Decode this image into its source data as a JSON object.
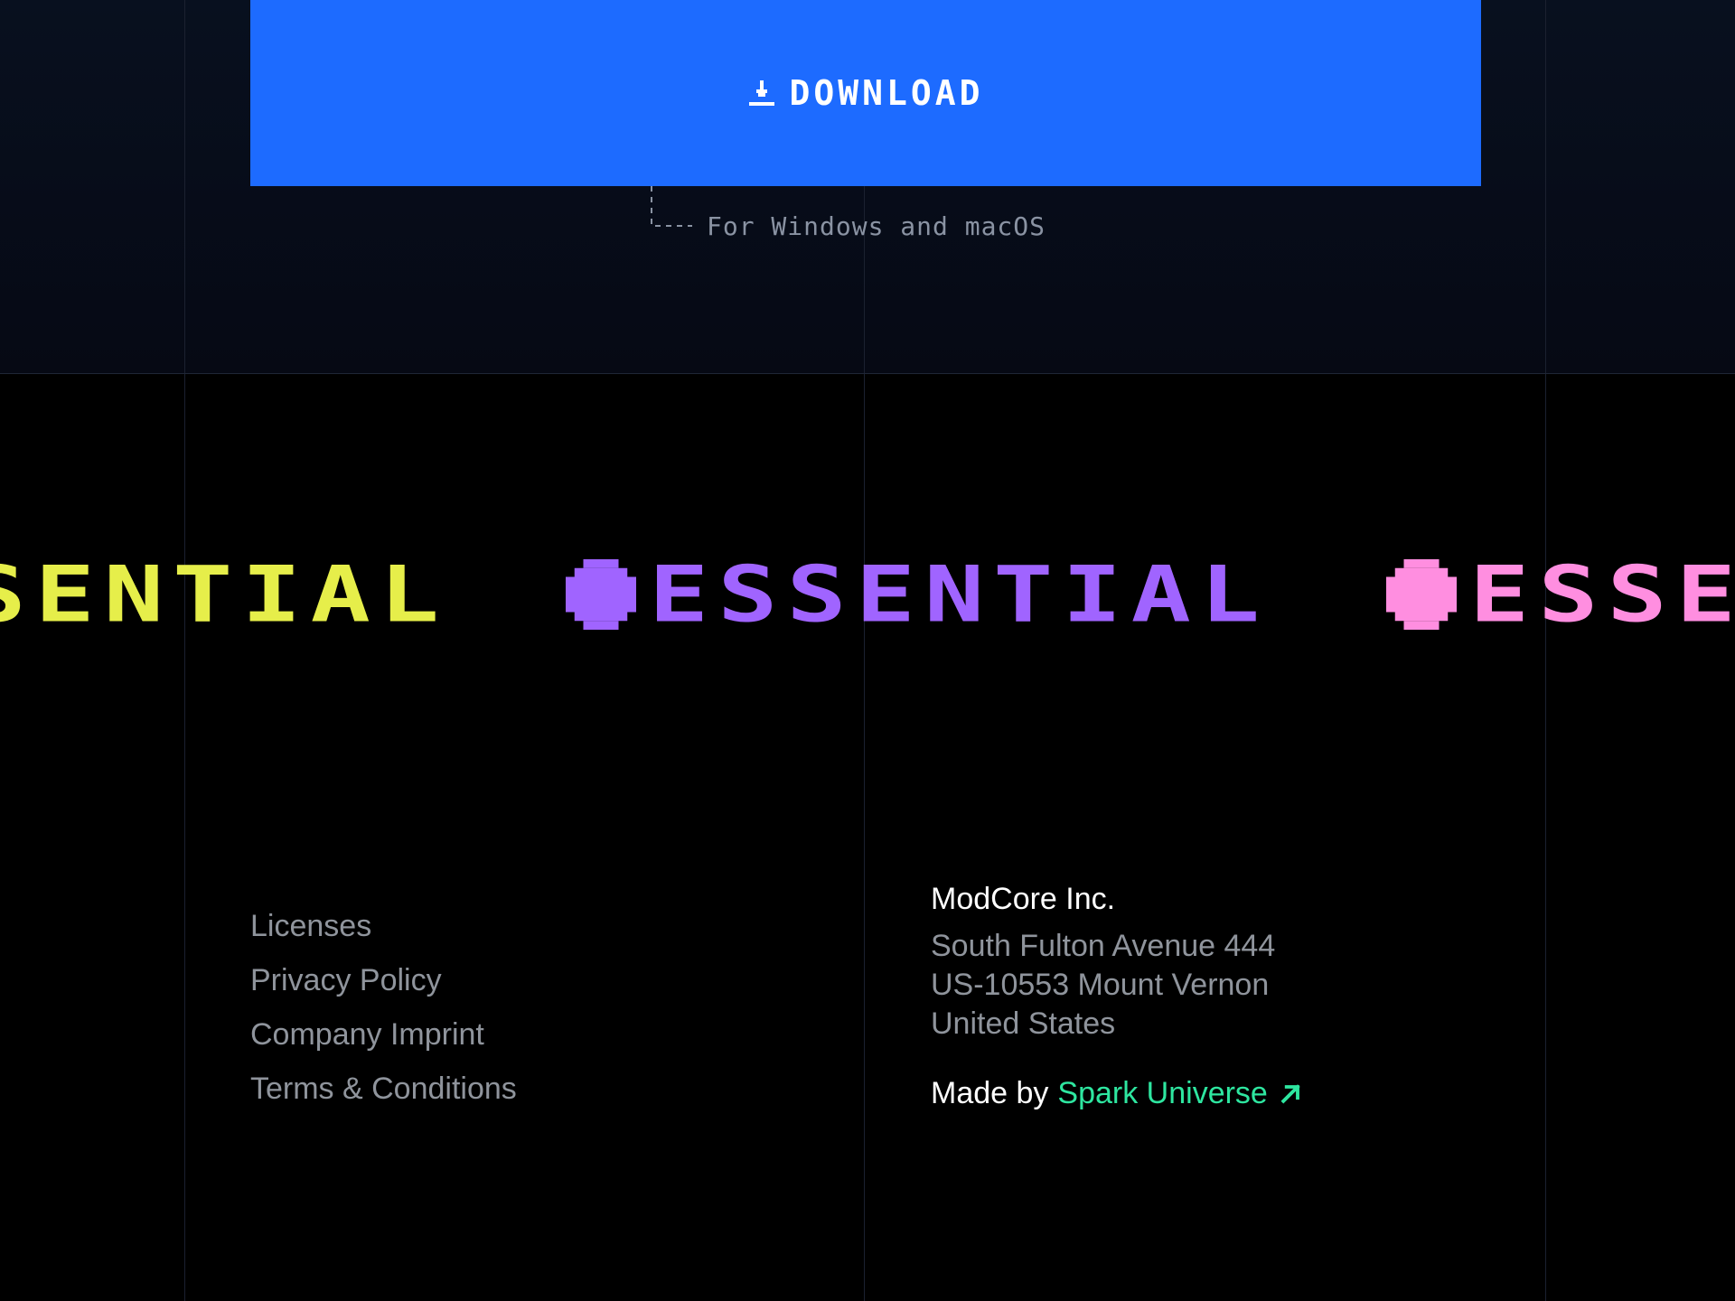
{
  "download": {
    "label": "DOWNLOAD",
    "icon": "download-icon",
    "platform_note": "For Windows and macOS"
  },
  "marquee": {
    "items": [
      {
        "text": "ESSENTIAL",
        "color": "#e6ee4a",
        "icon": "star-icon"
      },
      {
        "text": "ESSENTIAL",
        "color": "#a064ff",
        "icon": "star-icon"
      },
      {
        "text": "ESSENTIAL",
        "color": "#ff8ee0",
        "icon": "star-icon"
      }
    ]
  },
  "footer": {
    "links": [
      "Licenses",
      "Privacy Policy",
      "Company Imprint",
      "Terms & Conditions"
    ],
    "company": {
      "name": "ModCore Inc.",
      "address": [
        "South Fulton Avenue 444",
        "US-10553 Mount Vernon",
        "United States"
      ]
    },
    "credit": {
      "prefix": "Made by",
      "link_text": "Spark Universe",
      "link_color": "#2ee6a0",
      "icon": "arrow-up-right-icon"
    }
  },
  "colors": {
    "accent": "#1d6bff",
    "background": "#000000",
    "muted_text": "#8f949c"
  }
}
